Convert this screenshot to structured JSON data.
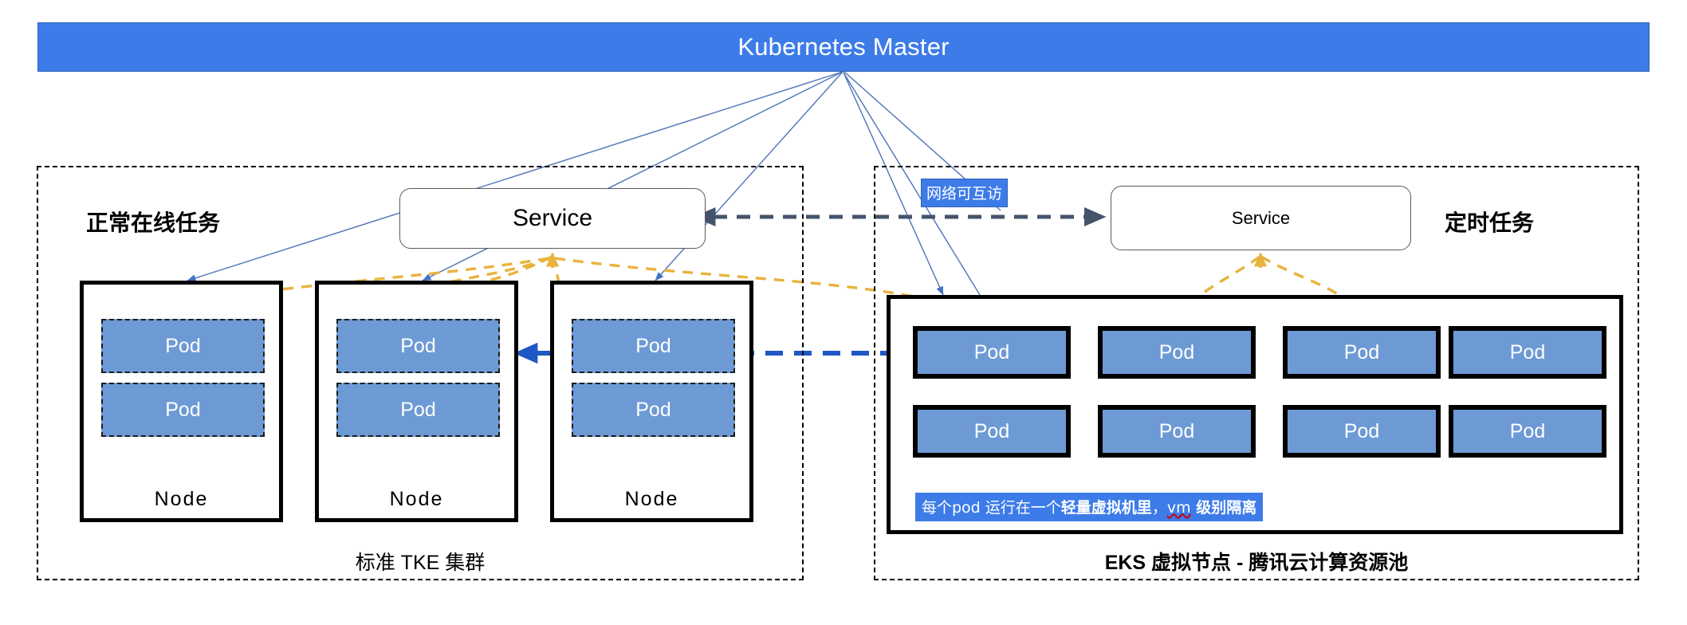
{
  "diagram": {
    "master": {
      "title": "Kubernetes Master",
      "color": "#3d7ce8"
    },
    "clusters": [
      {
        "id": "tke",
        "heading": "正常在线任务",
        "caption": "标准 TKE  集群",
        "service_label": "Service",
        "nodes": [
          {
            "name": "Node",
            "pods": [
              "Pod",
              "Pod"
            ]
          },
          {
            "name": "Node",
            "pods": [
              "Pod",
              "Pod"
            ]
          },
          {
            "name": "Node",
            "pods": [
              "Pod",
              "Pod"
            ]
          }
        ]
      },
      {
        "id": "eks",
        "heading": "定时任务",
        "caption": "EKS 虚拟节点 - 腾讯云计算资源池",
        "service_label": "Service",
        "pods_row1": [
          "Pod",
          "Pod",
          "Pod",
          "Pod"
        ],
        "pods_row2": [
          "Pod",
          "Pod",
          "Pod",
          "Pod"
        ],
        "note": {
          "prefix": "每个pod 运行在一个",
          "bold": "轻量虚拟机里",
          "comma": "，",
          "spellchecked": "vm",
          "suffix": " 级别隔离"
        }
      }
    ],
    "annotations": {
      "network_reachable": "网络可互访"
    },
    "colors": {
      "master_blue": "#3d7ce8",
      "pod_blue": "#6d9ad4",
      "connector_blue": "#4472c4",
      "connector_orange": "#e8b33e",
      "connector_gray": "#44546a",
      "highlight_blue": "#3d7ce8",
      "spell_red": "#cc0000"
    }
  }
}
